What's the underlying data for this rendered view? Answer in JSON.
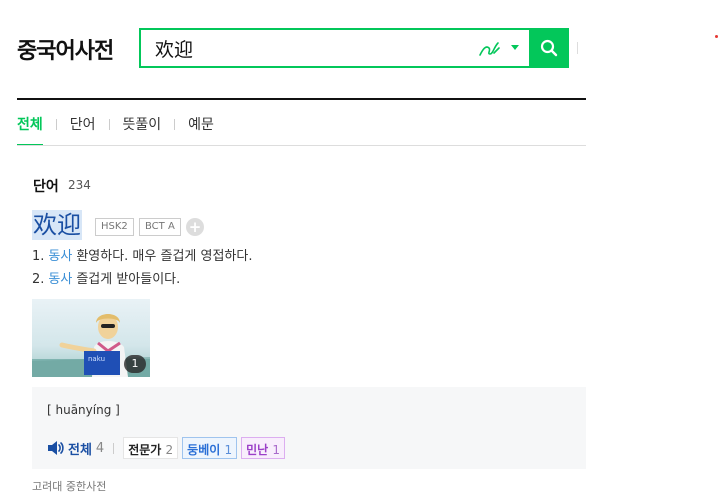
{
  "header": {
    "dictionary_title": "중국어사전",
    "search": {
      "value": "欢迎",
      "placeholder": ""
    },
    "accent_color": "#03c75a"
  },
  "tabs": [
    {
      "label": "전체",
      "active": true
    },
    {
      "label": "단어",
      "active": false
    },
    {
      "label": "뜻풀이",
      "active": false
    },
    {
      "label": "예문",
      "active": false
    }
  ],
  "section": {
    "title": "단어",
    "count": "234"
  },
  "entry": {
    "headword": "欢迎",
    "badges": [
      "HSK2",
      "BCT A"
    ],
    "plus_label": "+",
    "definitions": [
      {
        "num": "1.",
        "pos": "동사",
        "text": "환영하다. 매우 즐겁게 영접하다."
      },
      {
        "num": "2.",
        "pos": "동사",
        "text": "즐겁게 받아들이다."
      }
    ],
    "image_count": "1",
    "image_caption": "naku",
    "pinyin": "[ huānyíng ]",
    "pronunciation": {
      "all_label": "전체",
      "all_count": "4",
      "chips": [
        {
          "label": "전문가",
          "count": "2",
          "style": "expert"
        },
        {
          "label": "둥베이",
          "count": "1",
          "style": "dongbei"
        },
        {
          "label": "민난",
          "count": "1",
          "style": "minnan"
        }
      ]
    },
    "source": "고려대 중한사전"
  }
}
